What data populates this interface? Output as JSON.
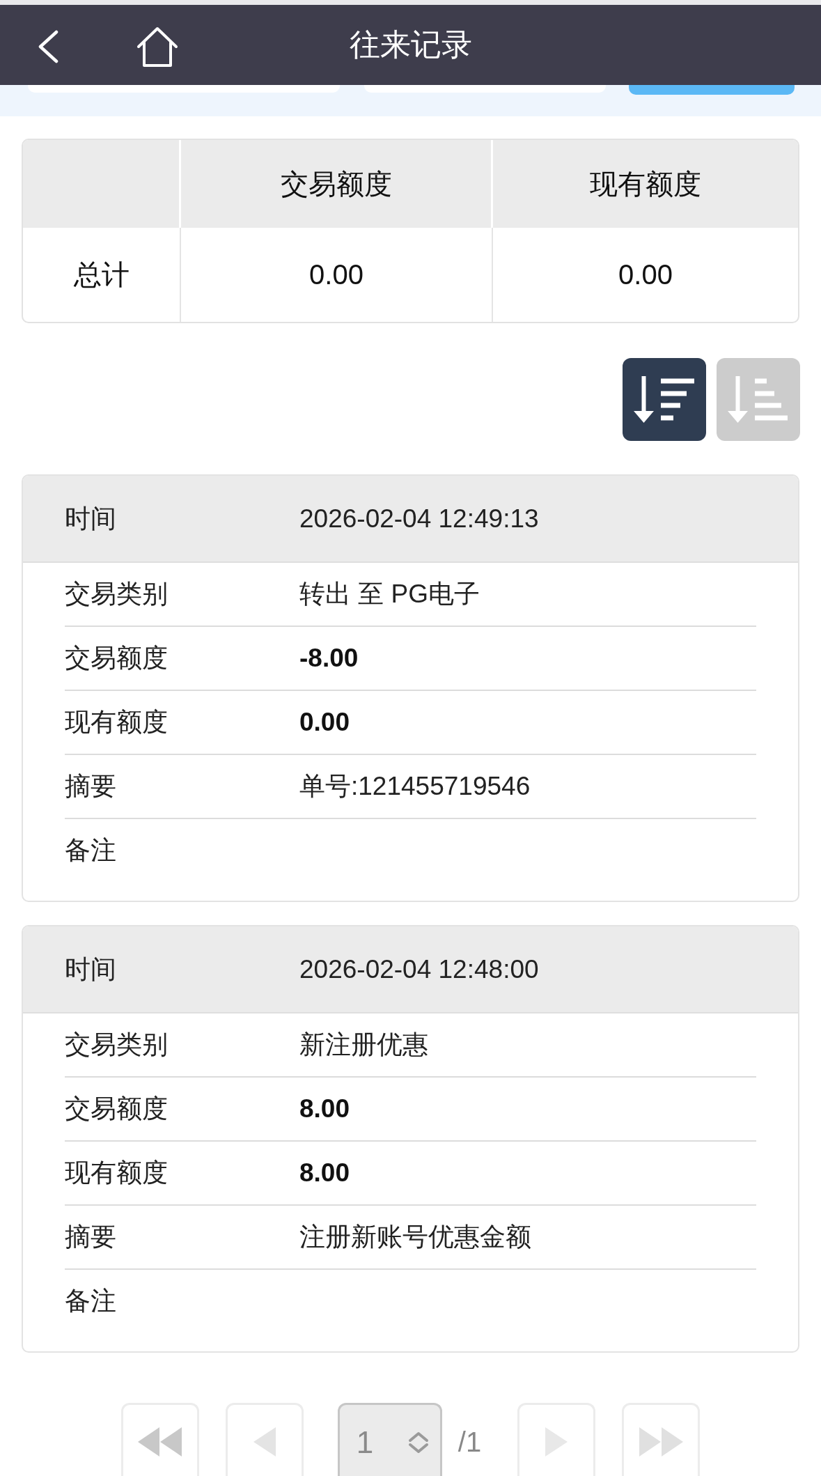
{
  "header": {
    "title": "往来记录"
  },
  "summary": {
    "columns": [
      "交易额度",
      "现有额度"
    ],
    "rows": [
      {
        "label": "总计",
        "values": [
          "0.00",
          "0.00"
        ]
      }
    ]
  },
  "sort_buttons": [
    {
      "kind": "descending",
      "selected": true
    },
    {
      "kind": "ascending",
      "selected": false
    }
  ],
  "records": [
    {
      "header": {
        "label": "时间",
        "value": "2026-02-04 12:49:13"
      },
      "rows": [
        {
          "kind": "text",
          "label": "交易类别",
          "value": "转出 至 PG电子"
        },
        {
          "kind": "amount",
          "label": "交易额度",
          "value": "-8.00"
        },
        {
          "kind": "amount",
          "label": "现有额度",
          "value": "0.00"
        },
        {
          "kind": "text",
          "label": "摘要",
          "value": "单号:121455719546"
        },
        {
          "label": "备注"
        }
      ]
    },
    {
      "header": {
        "label": "时间",
        "value": "2026-02-04 12:48:00"
      },
      "rows": [
        {
          "kind": "text",
          "label": "交易类别",
          "value": "新注册优惠"
        },
        {
          "kind": "amount",
          "label": "交易额度",
          "value": "8.00"
        },
        {
          "kind": "amount",
          "label": "现有额度",
          "value": "8.00"
        },
        {
          "kind": "text",
          "label": "摘要",
          "value": "注册新账号优惠金额"
        },
        {
          "label": "备注"
        }
      ]
    }
  ],
  "pagination": {
    "items": [
      {
        "kind": "first",
        "disabled": true
      },
      {
        "kind": "prev",
        "disabled": true
      },
      {
        "kind": "page_select",
        "value": "1",
        "disabled": true
      },
      {
        "kind": "total",
        "text": "/1"
      },
      {
        "kind": "next",
        "disabled": true
      },
      {
        "kind": "last",
        "disabled": true
      }
    ]
  }
}
